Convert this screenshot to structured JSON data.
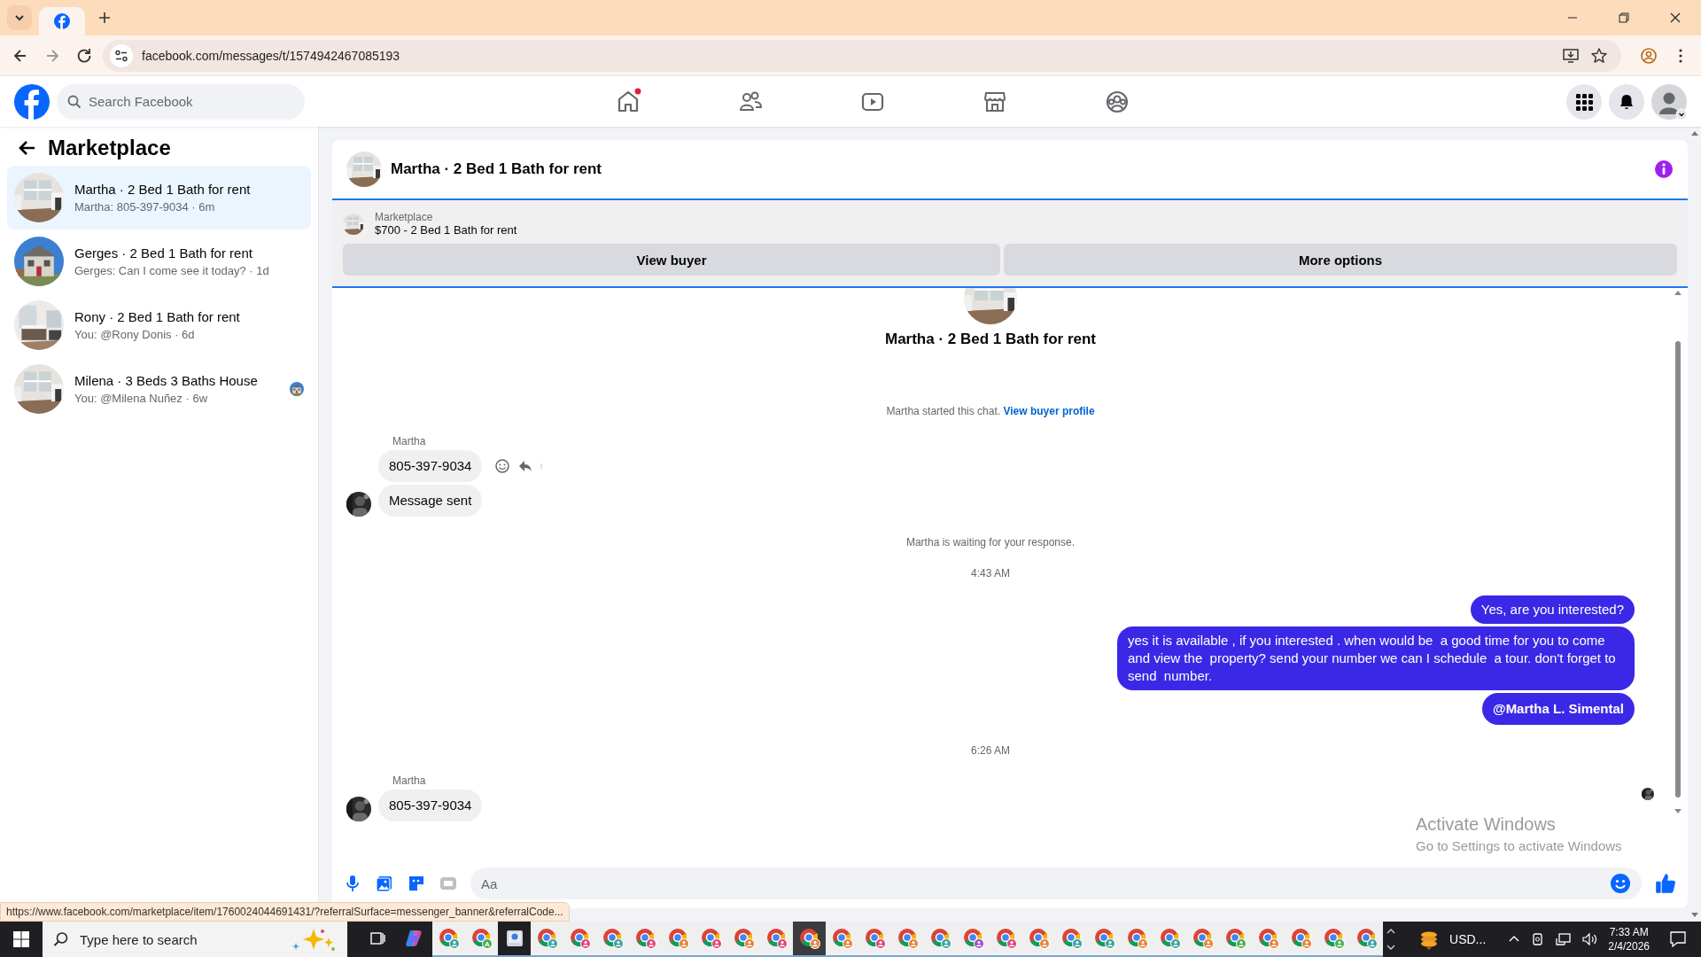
{
  "browser": {
    "address": "facebook.com/messages/t/1574942467085193",
    "status_url": "https://www.facebook.com/marketplace/item/1760024044691431/?referralSurface=messenger_banner&referralCode..."
  },
  "header": {
    "search_placeholder": "Search Facebook",
    "nav": [
      {
        "kind": "home",
        "notification": true
      },
      {
        "kind": "friends",
        "notification": false
      },
      {
        "kind": "video",
        "notification": false
      },
      {
        "kind": "marketplace",
        "notification": false
      },
      {
        "kind": "groups",
        "notification": false
      }
    ]
  },
  "sidebar": {
    "title": "Marketplace",
    "conversations": [
      {
        "title": "Martha · 2 Bed 1 Bath for rent",
        "preview": "Martha: 805-397-9034 · 6m",
        "selected": true,
        "seen_avatar": false
      },
      {
        "title": "Gerges · 2 Bed 1 Bath for rent",
        "preview": "Gerges: Can I come see it today? · 1d",
        "selected": false,
        "seen_avatar": false
      },
      {
        "title": "Rony · 2 Bed 1 Bath for rent",
        "preview": "You: @Rony Donis · 6d",
        "selected": false,
        "seen_avatar": false
      },
      {
        "title": "Milena · 3 Beds 3 Baths House",
        "preview": "You: @Milena Nuñez · 6w",
        "selected": false,
        "seen_avatar": true
      }
    ]
  },
  "chat": {
    "title": "Martha · 2 Bed 1 Bath for rent",
    "listing": {
      "label": "Marketplace",
      "text": "$700 - 2 Bed 1 Bath for rent",
      "buttons": [
        "View buyer",
        "More options"
      ]
    },
    "intro_title": "Martha · 2 Bed 1 Bath for rent",
    "started_text": "Martha started this chat.",
    "started_link": "View buyer profile",
    "messages": [
      {
        "kind": "sender",
        "text": "Martha"
      },
      {
        "kind": "incoming",
        "text": "805-397-9034",
        "avatar": false,
        "actions": true
      },
      {
        "kind": "incoming",
        "text": "Message sent",
        "avatar": true,
        "actions": false
      },
      {
        "kind": "notice",
        "text": "Martha is waiting for your response."
      },
      {
        "kind": "time",
        "text": "4:43 AM"
      },
      {
        "kind": "outgoing",
        "text": "Yes, are you interested?"
      },
      {
        "kind": "outgoing",
        "text": "yes it is available , if you interested . when would be  a good time for you to come and view the  property? send your number we can I schedule  a tour. don't forget to send  number."
      },
      {
        "kind": "mention",
        "text": "@Martha L. Simental"
      },
      {
        "kind": "time",
        "text": "6:26 AM"
      },
      {
        "kind": "sender",
        "text": "Martha"
      },
      {
        "kind": "incoming",
        "text": "805-397-9034",
        "avatar": true,
        "actions": false
      }
    ],
    "composer": {
      "placeholder": "Aa"
    }
  },
  "windows_notice": {
    "title": "Activate Windows",
    "text": "Go to Settings to activate Windows"
  },
  "taskbar": {
    "search_placeholder": "Type here to search",
    "tray_label": "USD...",
    "time": "7:33 AM",
    "date": "2/4/2026",
    "apps": [
      {
        "kind": "browser",
        "color": "#3aa3a0",
        "selected": false
      },
      {
        "kind": "browser",
        "color": "#4caf50",
        "badge_text": "A",
        "selected": false
      },
      {
        "kind": "app",
        "selected": false
      },
      {
        "kind": "browser",
        "color": "#3aa3a0",
        "selected": false
      },
      {
        "kind": "browser",
        "color": "#e0457b",
        "selected": false
      },
      {
        "kind": "browser",
        "color": "#3aa3a0",
        "selected": false
      },
      {
        "kind": "browser",
        "color": "#e0457b",
        "selected": false
      },
      {
        "kind": "browser",
        "color": "#e8823a",
        "selected": false
      },
      {
        "kind": "browser",
        "color": "#e0457b",
        "selected": false
      },
      {
        "kind": "browser",
        "color": "#e8823a",
        "selected": false
      },
      {
        "kind": "browser",
        "color": "#e0457b",
        "selected": false
      },
      {
        "kind": "browser",
        "color": "#e8823a",
        "selected": true
      },
      {
        "kind": "browser",
        "color": "#e8823a",
        "selected": false
      },
      {
        "kind": "browser",
        "color": "#e0457b",
        "selected": false
      },
      {
        "kind": "browser",
        "color": "#e8823a",
        "selected": false
      },
      {
        "kind": "browser",
        "color": "#3aa3a0",
        "selected": false
      },
      {
        "kind": "browser",
        "color": "#9b4fd0",
        "selected": false
      },
      {
        "kind": "browser",
        "color": "#e0457b",
        "selected": false
      },
      {
        "kind": "browser",
        "color": "#e8823a",
        "selected": false
      },
      {
        "kind": "browser",
        "color": "#3aa3a0",
        "selected": false
      },
      {
        "kind": "browser",
        "color": "#3aa3a0",
        "selected": false
      },
      {
        "kind": "browser",
        "color": "#e8823a",
        "selected": false
      },
      {
        "kind": "browser",
        "color": "#3aa3a0",
        "selected": false
      },
      {
        "kind": "browser",
        "color": "#e8823a",
        "selected": false
      },
      {
        "kind": "browser",
        "color": "#4caf50",
        "selected": false
      },
      {
        "kind": "browser",
        "color": "#e8823a",
        "selected": false
      },
      {
        "kind": "browser",
        "color": "#e8823a",
        "selected": false
      },
      {
        "kind": "browser",
        "color": "#4caf50",
        "selected": false
      },
      {
        "kind": "browser",
        "color": "#3aa3a0",
        "selected": false
      }
    ]
  }
}
